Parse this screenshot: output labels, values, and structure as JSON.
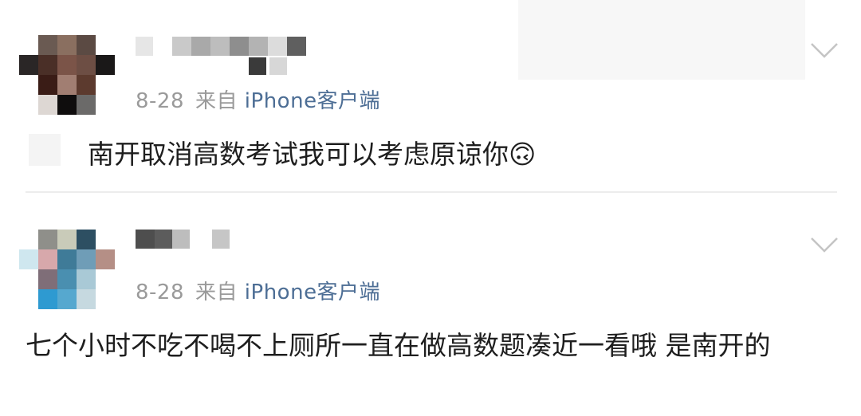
{
  "comments": [
    {
      "date": "8-28",
      "source_prefix": "来自",
      "source_device": "iPhone客户端",
      "text": "南开取消高数考试我可以考虑原谅你🙃"
    },
    {
      "date": "8-28",
      "source_prefix": "来自",
      "source_device": "iPhone客户端",
      "text": "七个小时不吃不喝不上厕所一直在做高数题凑近一看哦 是南开的"
    }
  ],
  "icons": {
    "expand": "chevron-down-icon"
  },
  "colors": {
    "meta_text": "#9a9a9a",
    "source_link": "#4d6e95",
    "body_text": "#1e1e1e",
    "divider": "#ececec"
  }
}
